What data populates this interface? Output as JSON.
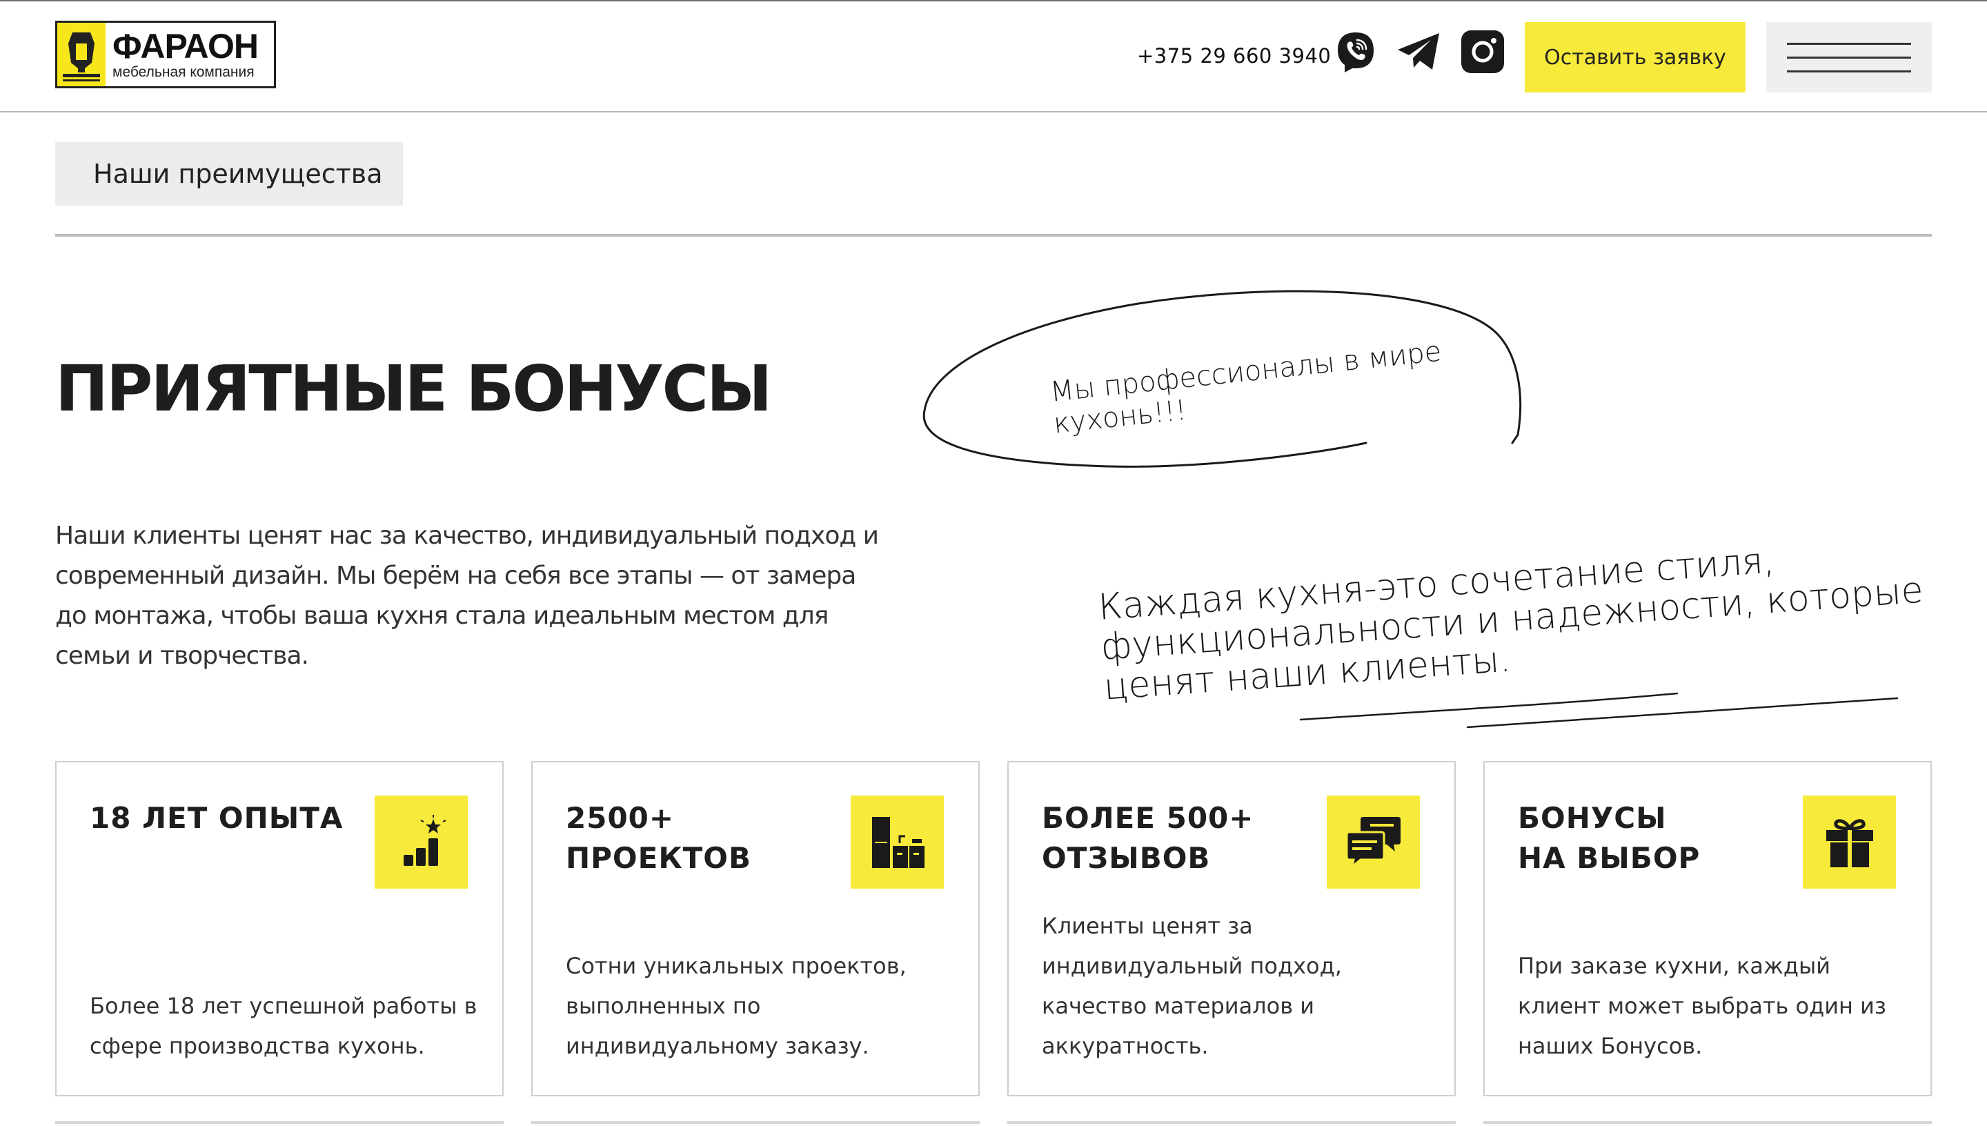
{
  "header": {
    "logo": {
      "name": "ФАРАОН",
      "subtitle": "мебельная компания"
    },
    "phone": "+375 29 660 3940",
    "social_icons": [
      "viber-icon",
      "telegram-icon",
      "instagram-icon"
    ],
    "cta_label": "Оставить заявку",
    "menu_icon": "hamburger-menu-icon"
  },
  "breadcrumb": {
    "label": "Наши преимущества"
  },
  "main": {
    "title": "ПРИЯТНЫЕ БОНУСЫ",
    "lead": "Наши клиенты ценят нас за качество, индивидуальный подход и современный дизайн. Мы берём на себя все этапы — от замера до монтажа, чтобы ваша кухня стала идеальным местом для семьи и творчества.",
    "handwritten_note_1": "Мы профессионалы в мире кухонь!!!",
    "handwritten_note_2": "Каждая кухня-это сочетание стиля, функциональности и надежности, которые ценят наши клиенты."
  },
  "cards": [
    {
      "title_line1": "18 ЛЕТ ОПЫТА",
      "title_line2": "",
      "icon": "growth-chart-star-icon",
      "text": "Более 18 лет успешной работы в сфере производства кухонь."
    },
    {
      "title_line1": "2500+",
      "title_line2": "ПРОЕКТОВ",
      "icon": "kitchen-cabinets-icon",
      "text": "Сотни уникальных проектов, выполненных по индивидуальному заказу."
    },
    {
      "title_line1": "БОЛЕЕ 500+",
      "title_line2": "ОТЗЫВОВ",
      "icon": "chat-bubbles-icon",
      "text": "Клиенты ценят за индивидуальный подход, качество материалов и аккуратность."
    },
    {
      "title_line1": "БОНУСЫ",
      "title_line2": "НА ВЫБОР",
      "icon": "gift-icon",
      "text": "При заказе кухни, каждый клиент может выбрать один из наших Бонусов."
    }
  ],
  "colors": {
    "accent": "#f7ea3a",
    "text": "#1e1e1e",
    "border": "#cfcfcf",
    "menu_bg": "#efefef"
  }
}
